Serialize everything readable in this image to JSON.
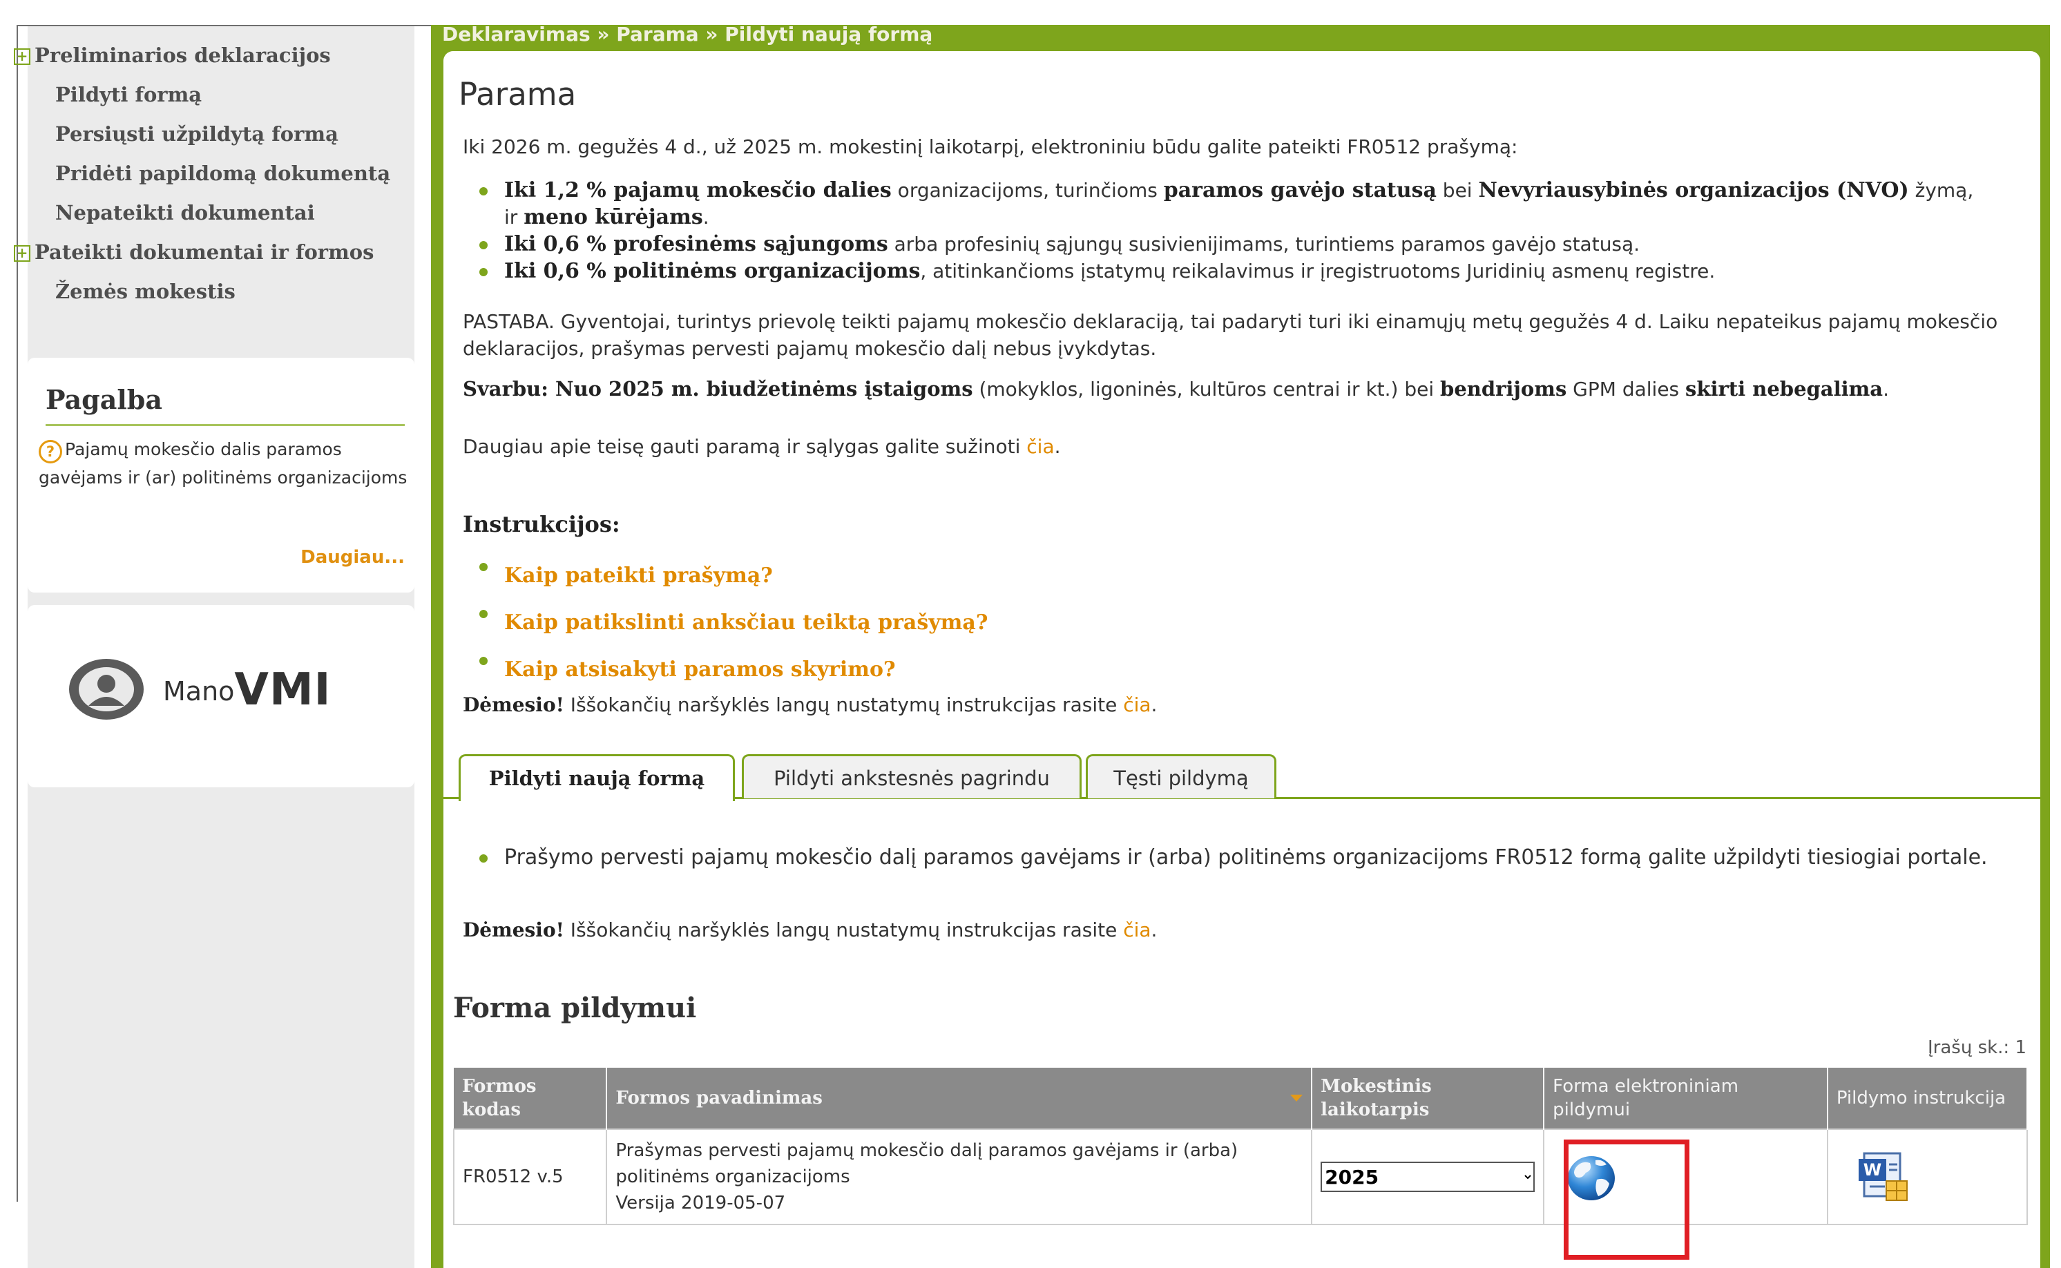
{
  "sidebar": {
    "nav": [
      {
        "label": "Preliminarios deklaracijos",
        "expandable": true
      },
      {
        "label": "Pildyti formą",
        "expandable": false
      },
      {
        "label": "Persiųsti užpildytą formą",
        "expandable": false
      },
      {
        "label": "Pridėti papildomą dokumentą",
        "expandable": false
      },
      {
        "label": "Nepateikti dokumentai",
        "expandable": false
      },
      {
        "label": "Pateikti dokumentai ir formos",
        "expandable": true
      },
      {
        "label": "Žemės mokestis",
        "expandable": false
      }
    ],
    "help": {
      "title": "Pagalba",
      "text": "Pajamų mokesčio dalis paramos gavėjams ir (ar) politinėms organizacijoms",
      "more": "Daugiau..."
    },
    "logo": {
      "small": "Mano",
      "big": "VMI"
    }
  },
  "breadcrumb": "Deklaravimas » Parama » Pildyti naują formą",
  "main": {
    "title": "Parama",
    "intro": "Iki 2026 m. gegužės 4 d., už 2025 m. mokestinį laikotarpį, elektroniniu būdu galite pateikti FR0512 prašymą:",
    "bullets": {
      "b1_bold1": "Iki 1,2 % pajamų mokesčio dalies",
      "b1_text1": " organizacijoms, turinčioms ",
      "b1_bold2": "paramos gavėjo statusą",
      "b1_text2": " bei ",
      "b1_bold3": "Nevyriausybinės organizacijos (NVO)",
      "b1_bold4": " žymą",
      "b1_text3": ", ir ",
      "b1_bold5": "meno kūrėjams",
      "b1_text4": ".",
      "b2_bold": "Iki 0,6 % profesinėms sąjungoms",
      "b2_text": " arba profesinių sąjungų susivienijimams, turintiems paramos gavėjo statusą.",
      "b3_bold": "Iki 0,6 % politinėms organizacijoms",
      "b3_text": ", atitinkančioms įstatymų reikalavimus ir įregistruotoms Juridinių asmenų registre."
    },
    "note": "PASTABA. Gyventojai, turintys prievolę teikti pajamų mokesčio deklaraciją, tai padaryti turi iki einamųjų metų gegužės 4 d. Laiku nepateikus pajamų mokesčio deklaracijos, prašymas pervesti pajamų mokesčio dalį nebus įvykdytas.",
    "svarbu": {
      "bold1": "Svarbu: Nuo 2025 m. biudžetinėms įstaigoms",
      "text1": " (mokyklos, ligoninės, kultūros centrai ir kt.) bei ",
      "bold2": "bendrijoms",
      "text2": " GPM dalies ",
      "bold3": "skirti nebegalima",
      "text3": "."
    },
    "more_text": "Daugiau apie teisę gauti paramą ir sąlygas galite sužinoti ",
    "link_cia": "čia",
    "period": ".",
    "instructions_title": "Instrukcijos:",
    "instructions": [
      "Kaip pateikti prašymą?",
      "Kaip patikslinti anksčiau teiktą prašymą?",
      "Kaip atsisakyti paramos skyrimo?"
    ],
    "demesio_bold": "Dėmesio!",
    "demesio_text": " Iššokančių naršyklės langų nustatymų instrukcijas rasite "
  },
  "tabs": [
    "Pildyti naują formą",
    "Pildyti ankstesnės pagrindu",
    "Tęsti pildymą"
  ],
  "tab_content": {
    "bullet": "Prašymo pervesti pajamų mokesčio dalį paramos gavėjams ir (arba) politinėms organizacijoms FR0512 formą galite užpildyti tiesiogiai portale."
  },
  "forma": {
    "title": "Forma pildymui",
    "count": "Įrašų sk.: 1",
    "headers": [
      "Formos kodas",
      "Formos pavadinimas",
      "Mokestinis laikotarpis",
      "Forma elektroniniam pildymui",
      "Pildymo instrukcija"
    ],
    "rows": [
      {
        "code": "FR0512 v.5",
        "name_line1": "Prašymas pervesti pajamų mokesčio dalį paramos gavėjams ir (arba)",
        "name_line2": "politinėms organizacijoms",
        "name_line3": "Versija 2019-05-07",
        "period": "2025",
        "eform_icon": "globe-icon",
        "instruction_icon": "word-document-icon"
      }
    ]
  },
  "colors": {
    "accent": "#7ea51c",
    "link": "#e08a00",
    "highlight": "#e01e24",
    "header_gray": "#8a8a8a"
  }
}
